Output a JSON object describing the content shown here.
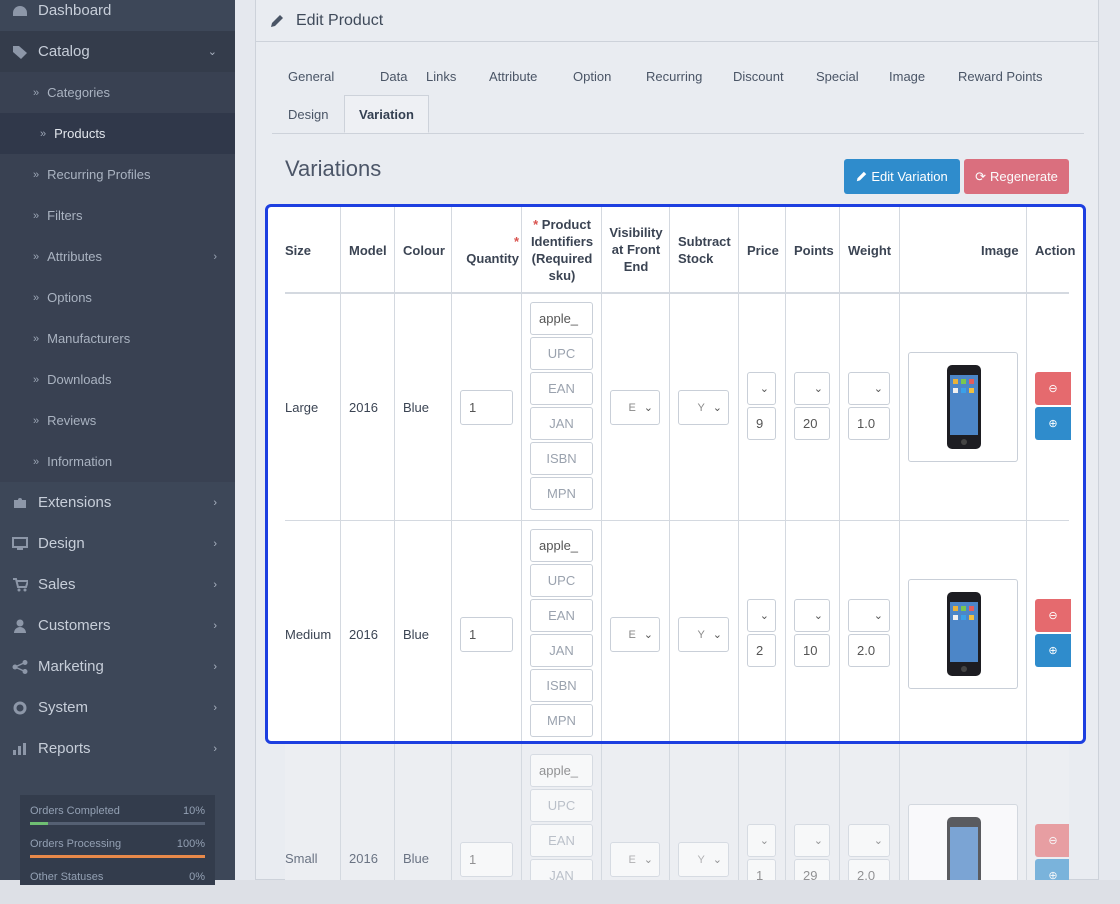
{
  "sidebar": {
    "top_items": [
      {
        "label": "Dashboard",
        "icon": "dashboard-icon"
      },
      {
        "label": "Catalog",
        "icon": "tags-icon"
      },
      {
        "label": "Extensions",
        "icon": "puzzle-icon"
      },
      {
        "label": "Design",
        "icon": "desktop-icon"
      },
      {
        "label": "Sales",
        "icon": "cart-icon"
      },
      {
        "label": "Customers",
        "icon": "user-icon"
      },
      {
        "label": "Marketing",
        "icon": "share-icon"
      },
      {
        "label": "System",
        "icon": "gear-icon"
      },
      {
        "label": "Reports",
        "icon": "bar-chart-icon"
      }
    ],
    "catalog_items": [
      "Categories",
      "Products",
      "Recurring Profiles",
      "Filters",
      "Attributes",
      "Options",
      "Manufacturers",
      "Downloads",
      "Reviews",
      "Information"
    ],
    "stats": [
      {
        "label": "Orders Completed",
        "pct": "10%",
        "value": 0.1,
        "color": "#6fbf73"
      },
      {
        "label": "Orders Processing",
        "pct": "100%",
        "value": 1.0,
        "color": "#e8894a"
      },
      {
        "label": "Other Statuses",
        "pct": "0%",
        "value": 0.0,
        "color": "#cccccc"
      }
    ]
  },
  "panel": {
    "title": "Edit Product",
    "tabs": [
      "General",
      "Data",
      "Links",
      "Attribute",
      "Option",
      "Recurring",
      "Discount",
      "Special",
      "Image",
      "Reward Points",
      "Design",
      "Variation"
    ],
    "section_title": "Variations",
    "edit_button": "Edit Variation",
    "regen_button": "Regenerate"
  },
  "table": {
    "headers": {
      "size": "Size",
      "model": "Model",
      "colour": "Colour",
      "quantity": "Quantity",
      "identifiers_1": "Product",
      "identifiers_2": "Identifiers",
      "identifiers_3": "(Required",
      "identifiers_4": "sku)",
      "visibility_1": "Visibility",
      "visibility_2": "at Front",
      "visibility_3": "End",
      "subtract_1": "Subtract",
      "subtract_2": "Stock",
      "price": "Price",
      "points": "Points",
      "weight": "Weight",
      "image": "Image",
      "action": "Action",
      "required_mark": "*"
    },
    "placeholders": {
      "upc": "UPC",
      "ean": "EAN",
      "jan": "JAN",
      "isbn": "ISBN",
      "mpn": "MPN"
    },
    "rows": [
      {
        "size": "Large",
        "model": "2016",
        "colour": "Blue",
        "quantity": "1",
        "sku": "apple_",
        "visibility": "E",
        "subtract": "Y",
        "price": "9",
        "points": "20",
        "weight": "1.0"
      },
      {
        "size": "Medium",
        "model": "2016",
        "colour": "Blue",
        "quantity": "1",
        "sku": "apple_",
        "visibility": "E",
        "subtract": "Y",
        "price": "2",
        "points": "10",
        "weight": "2.0"
      },
      {
        "size": "Small",
        "model": "2016",
        "colour": "Blue",
        "quantity": "1",
        "sku": "apple_",
        "visibility": "E",
        "subtract": "Y",
        "price": "1",
        "points": "29",
        "weight": "2.0"
      }
    ]
  }
}
